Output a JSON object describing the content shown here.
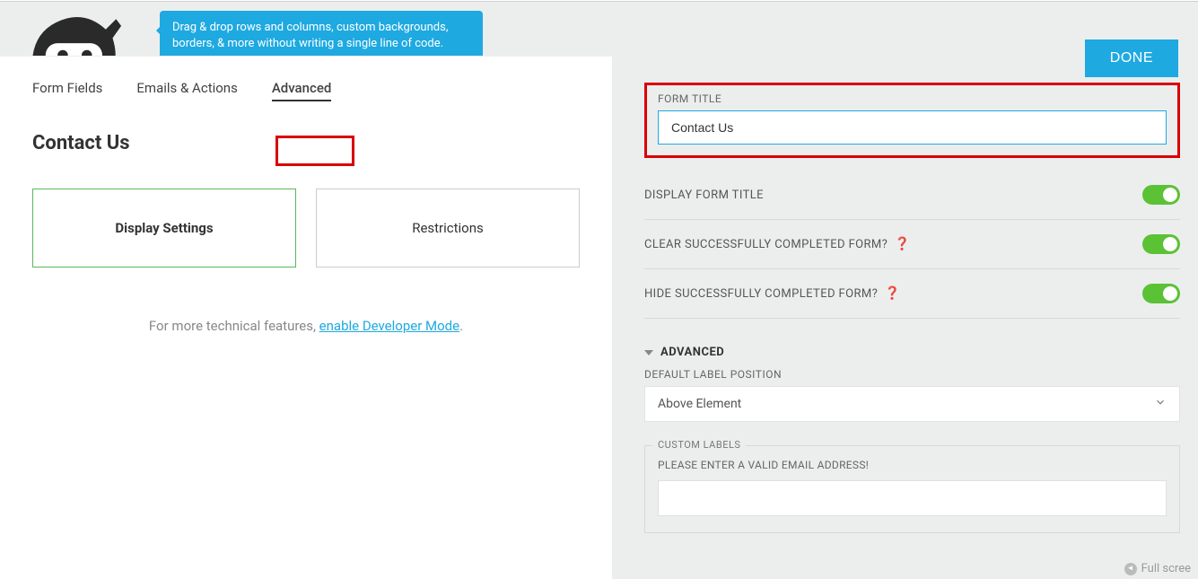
{
  "tooltip": "Drag & drop rows and columns, custom backgrounds, borders, & more without writing a single line of code.",
  "done_label": "DONE",
  "tabs": {
    "form_fields": "Form Fields",
    "emails_actions": "Emails & Actions",
    "advanced": "Advanced"
  },
  "page_title": "Contact Us",
  "cards": {
    "display_settings": "Display Settings",
    "restrictions": "Restrictions"
  },
  "dev_note_prefix": "For more technical features, ",
  "dev_note_link": "enable Developer Mode",
  "dev_note_suffix": ".",
  "form_title_label": "FORM TITLE",
  "form_title_value": "Contact Us",
  "toggles": {
    "display_form_title": "DISPLAY FORM TITLE",
    "clear_completed": "CLEAR SUCCESSFULLY COMPLETED FORM?",
    "hide_completed": "HIDE SUCCESSFULLY COMPLETED FORM?"
  },
  "advanced_section": "ADVANCED",
  "default_label_position_label": "DEFAULT LABEL POSITION",
  "default_label_position_value": "Above Element",
  "custom_labels_legend": "CUSTOM LABELS",
  "email_error_label": "PLEASE ENTER A VALID EMAIL ADDRESS!",
  "fullscreen_hint": "Full scree"
}
